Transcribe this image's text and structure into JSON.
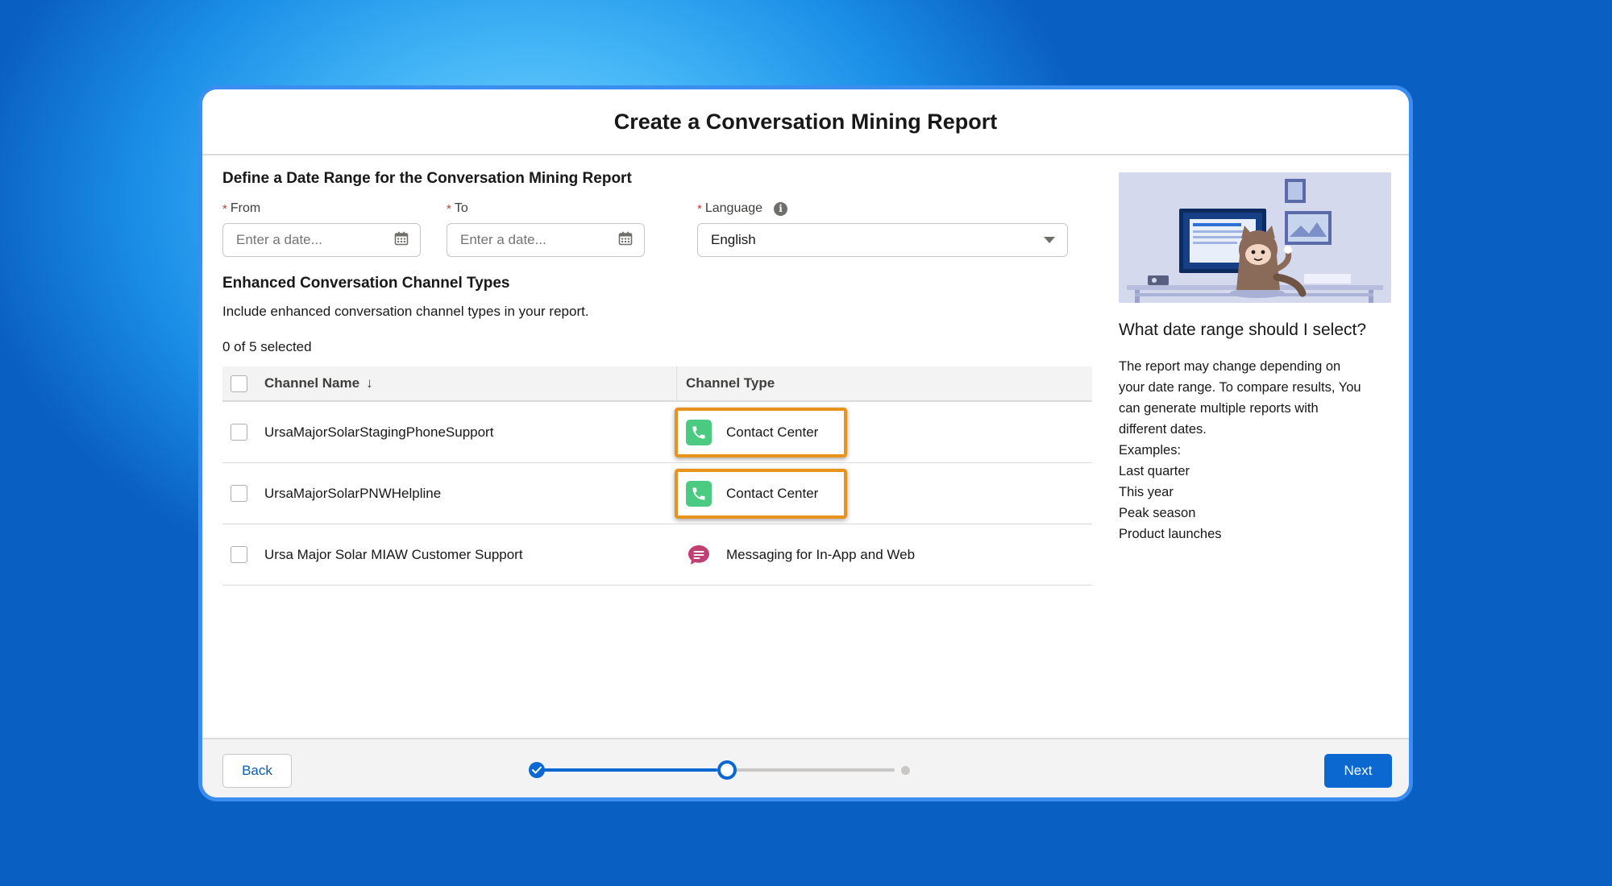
{
  "modal": {
    "title": "Create a Conversation Mining Report"
  },
  "date_section": {
    "title": "Define a Date Range for the Conversation Mining Report",
    "from": {
      "required_mark": "*",
      "label": "From",
      "placeholder": "Enter a date...",
      "icon": "calendar-icon"
    },
    "to": {
      "required_mark": "*",
      "label": "To",
      "placeholder": "Enter a date...",
      "icon": "calendar-icon"
    },
    "language": {
      "required_mark": "*",
      "label": "Language",
      "info_glyph": "i",
      "selected": "English",
      "icon": "chevron-down-icon"
    }
  },
  "channels": {
    "title": "Enhanced Conversation Channel Types",
    "description": "Include enhanced conversation channel types in your report.",
    "count_text": "0 of 5 selected",
    "columns": {
      "name": "Channel Name",
      "sort_glyph": "↓",
      "type": "Channel Type"
    },
    "rows": [
      {
        "name": "UrsaMajorSolarStagingPhoneSupport",
        "type": "Contact Center",
        "icon": "phone-icon",
        "highlighted": true
      },
      {
        "name": "UrsaMajorSolarPNWHelpline",
        "type": "Contact Center",
        "icon": "phone-icon",
        "highlighted": true
      },
      {
        "name": "Ursa Major Solar MIAW Customer Support",
        "type": "Messaging for In-App and Web",
        "icon": "chat-bubble-icon",
        "highlighted": false
      }
    ]
  },
  "help_panel": {
    "title": "What date range should I select?",
    "lines": [
      "The report may change depending on",
      "your date range. To compare results, You",
      "can generate multiple reports with",
      "different dates.",
      "Examples:",
      "Last quarter",
      "This year",
      "Peak season",
      "Product launches"
    ]
  },
  "footer": {
    "back_label": "Back",
    "next_label": "Next",
    "progress_fraction": 0.5,
    "steps_total": 3,
    "current_step": 2
  },
  "colors": {
    "brand_blue": "#0b68d1",
    "highlight_orange": "#e8931c",
    "contact_center_green": "#4bca81",
    "messaging_pink": "#c23f74"
  }
}
